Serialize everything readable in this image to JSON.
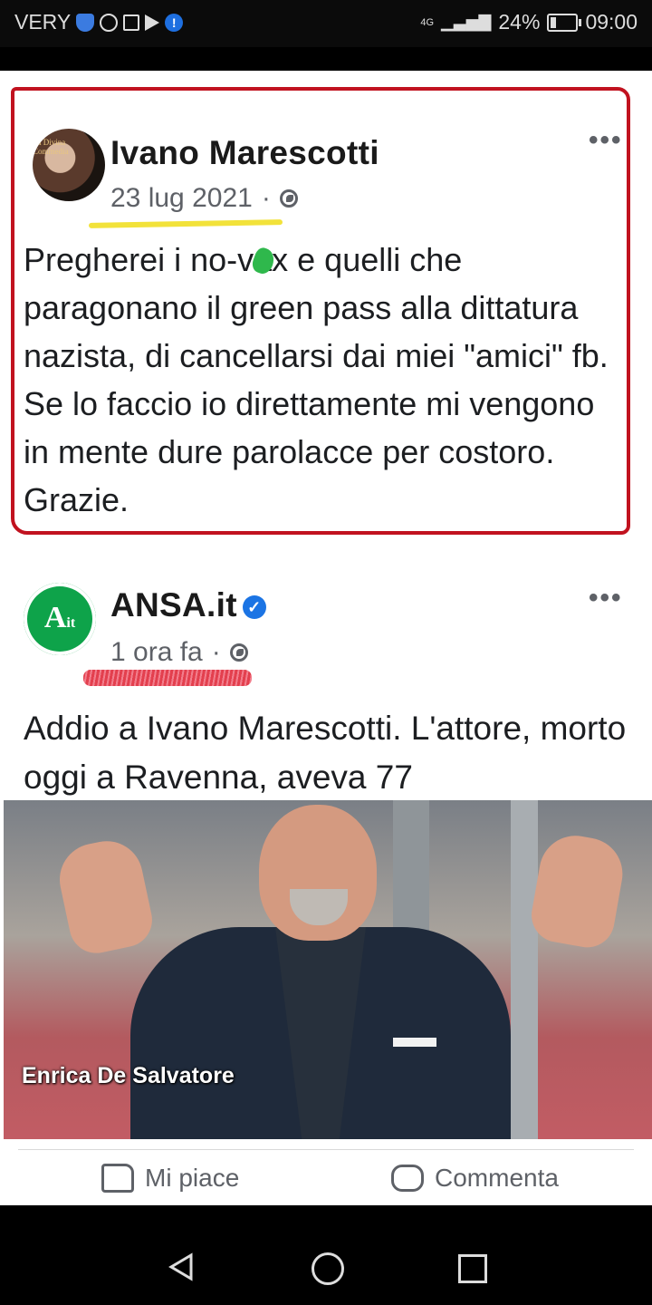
{
  "status_bar": {
    "carrier": "VERY",
    "signal": "4G",
    "battery": "24%",
    "time": "09:00"
  },
  "post1": {
    "author": "Ivano Marescotti",
    "avatar_text": "La Divina Commedia",
    "date": "23 lug 2021",
    "separator": "·",
    "more": "•••",
    "text": "Pregherei i no-vax e quelli che paragonano il green pass alla dittatura nazista, di cancellarsi dai miei \"amici\" fb. Se lo faccio io direttamente mi vengono in mente dure parolacce per costoro. Grazie."
  },
  "post2": {
    "author": "ANSA.it",
    "avatar_text": "A",
    "avatar_sub": "it",
    "time": "1 ora fa",
    "separator": "·",
    "more": "•••",
    "text": "Addio a Ivano Marescotti. L'attore, morto oggi a Ravenna, aveva 77",
    "photo_caption": "Enrica De Salvatore"
  },
  "actions": {
    "like_label": "Mi piace",
    "comment_label": "Commenta"
  },
  "colors": {
    "frame_red": "#c1121f",
    "highlight_yellow": "#f2e23a",
    "ansa_green": "#0ea34a",
    "verified_blue": "#1b74e4"
  }
}
